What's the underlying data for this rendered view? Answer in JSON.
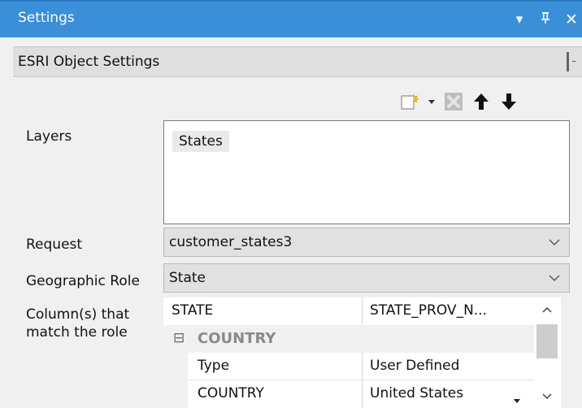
{
  "window": {
    "title": "Settings"
  },
  "header": {
    "title": "ESRI Object Settings"
  },
  "toolbar": {
    "add_icon": "new-layer-icon",
    "delete_icon": "delete-icon",
    "up_icon": "move-up-icon",
    "down_icon": "move-down-icon"
  },
  "labels": {
    "layers": "Layers",
    "request": "Request",
    "geo_role": "Geographic Role",
    "columns_line1": "Column(s) that",
    "columns_line2": "match the role"
  },
  "layers": {
    "items": [
      "States"
    ]
  },
  "request": {
    "value": "customer_states3"
  },
  "geo_role": {
    "value": "State"
  },
  "grid": {
    "header_left": "STATE",
    "header_right": "STATE_PROV_N...",
    "group_toggle": "⊟",
    "group_label": "COUNTRY",
    "rows": [
      {
        "name": "Type",
        "value": "User Defined"
      },
      {
        "name": "COUNTRY",
        "value": "United States"
      }
    ]
  },
  "colors": {
    "titlebar": "#3a8fd9",
    "group_text": "#8a8a8a"
  }
}
